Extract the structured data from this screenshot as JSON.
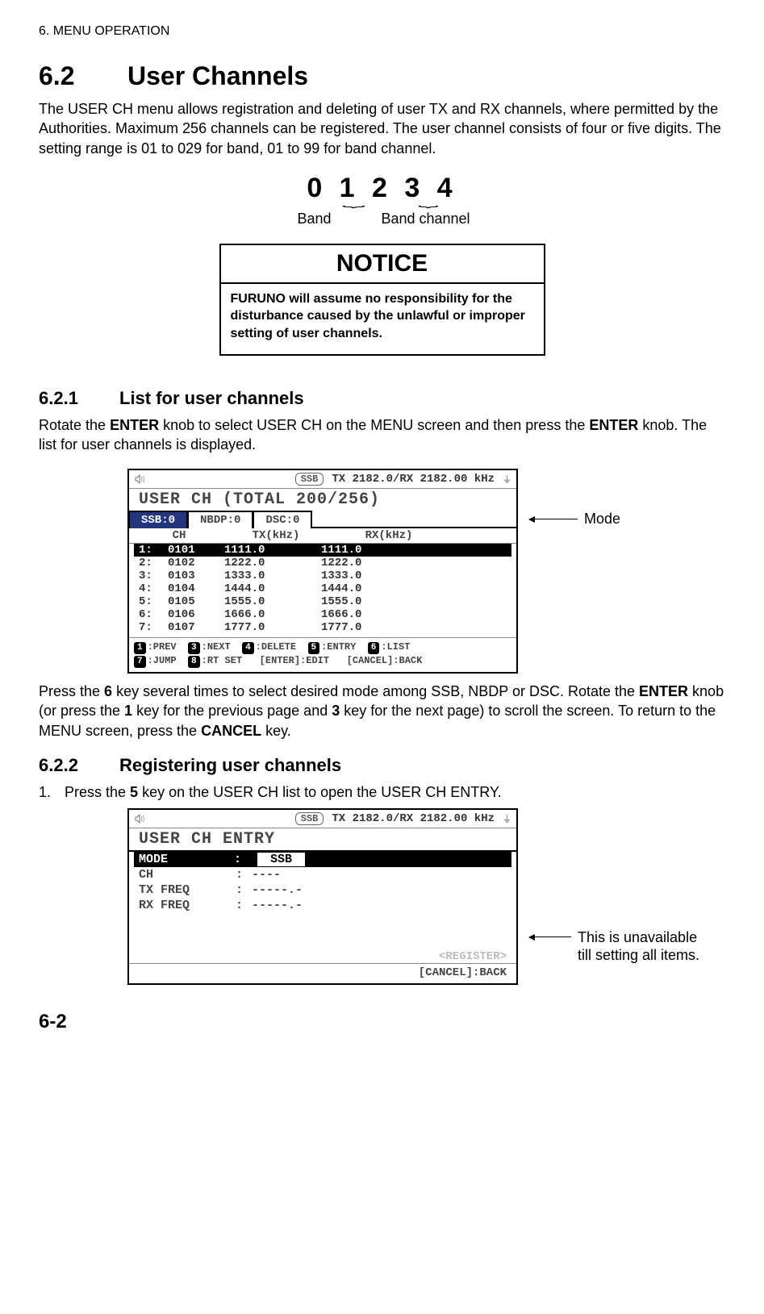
{
  "header": {
    "crumb": "6. MENU OPERATION"
  },
  "section62": {
    "num": "6.2",
    "title": "User Channels",
    "body": "The USER CH menu allows registration and deleting of user TX and RX channels, where permitted by the Authorities. Maximum 256 channels can be registered. The user channel consists of four or five digits. The setting range is 01 to 029 for band, 01 to 99 for band channel."
  },
  "digit_figure": {
    "digits": "0 1 2 3 4",
    "band_label": "Band",
    "bandch_label": "Band channel"
  },
  "notice": {
    "title": "NOTICE",
    "body": "FURUNO will assume no responsibility for the disturbance caused by the unlawful or improper setting of user channels."
  },
  "section621": {
    "num": "6.2.1",
    "title": "List for user channels",
    "intro_1": "Rotate the ",
    "intro_2": "ENTER",
    "intro_3": " knob to select USER CH on the MENU screen and then press the ",
    "intro_4": "ENTER",
    "intro_5": " knob. The list for user channels is displayed.",
    "after_1": "Press the ",
    "after_2": "6",
    "after_3": " key several times to select desired mode among SSB, NBDP or DSC. Rotate the ",
    "after_4": "ENTER",
    "after_5": " knob (or press the ",
    "after_6": "1",
    "after_7": " key for the previous page and ",
    "after_8": "3",
    "after_9": " key for the next page) to scroll the screen. To return to the MENU screen, press the ",
    "after_10": "CANCEL",
    "after_11": " key."
  },
  "list_lcd": {
    "ssb_pill": "SSB",
    "top_freq": "TX 2182.0/RX 2182.00 kHz",
    "title": "USER CH  (TOTAL 200/256)",
    "tab_ssb": "SSB:0",
    "tab_nbdp": "NBDP:0",
    "tab_dsc": "DSC:0",
    "col_ch": "CH",
    "col_tx": "TX(kHz)",
    "col_rx": "RX(kHz)",
    "rows": [
      {
        "idx": "1:",
        "ch": "0101",
        "tx": "1111.0",
        "rx": "1111.0"
      },
      {
        "idx": "2:",
        "ch": "0102",
        "tx": "1222.0",
        "rx": "1222.0"
      },
      {
        "idx": "3:",
        "ch": "0103",
        "tx": "1333.0",
        "rx": "1333.0"
      },
      {
        "idx": "4:",
        "ch": "0104",
        "tx": "1444.0",
        "rx": "1444.0"
      },
      {
        "idx": "5:",
        "ch": "0105",
        "tx": "1555.0",
        "rx": "1555.0"
      },
      {
        "idx": "6:",
        "ch": "0106",
        "tx": "1666.0",
        "rx": "1666.0"
      },
      {
        "idx": "7:",
        "ch": "0107",
        "tx": "1777.0",
        "rx": "1777.0"
      }
    ],
    "footer_keys": {
      "k1": "1",
      "l1": ":PREV",
      "k3": "3",
      "l3": ":NEXT",
      "k4": "4",
      "l4": ":DELETE",
      "k5": "5",
      "l5": ":ENTRY",
      "k6": "6",
      "l6": ":LIST",
      "k7": "7",
      "l7": ":JUMP",
      "k8": "8",
      "l8": ":RT SET",
      "enter": "[ENTER]:EDIT",
      "cancel": "[CANCEL]:BACK"
    },
    "mode_callout": "Mode"
  },
  "section622": {
    "num": "6.2.2",
    "title": "Registering user channels",
    "step1_1": "Press the ",
    "step1_2": "5",
    "step1_3": " key on the USER CH list to open the USER CH ENTRY."
  },
  "entry_lcd": {
    "ssb_pill": "SSB",
    "top_freq": "TX 2182.0/RX 2182.00 kHz",
    "title": "USER CH ENTRY",
    "mode_label": "MODE",
    "mode_value": "SSB",
    "ch_label": "CH",
    "ch_value": "----",
    "tx_label": "TX FREQ",
    "tx_value": "-----.-",
    "rx_label": "RX FREQ",
    "rx_value": "-----.-",
    "register": "<REGISTER>",
    "cancel": "[CANCEL]:BACK",
    "callout_line1": "This is unavailable",
    "callout_line2": "till setting all items."
  },
  "page_num": "6-2"
}
